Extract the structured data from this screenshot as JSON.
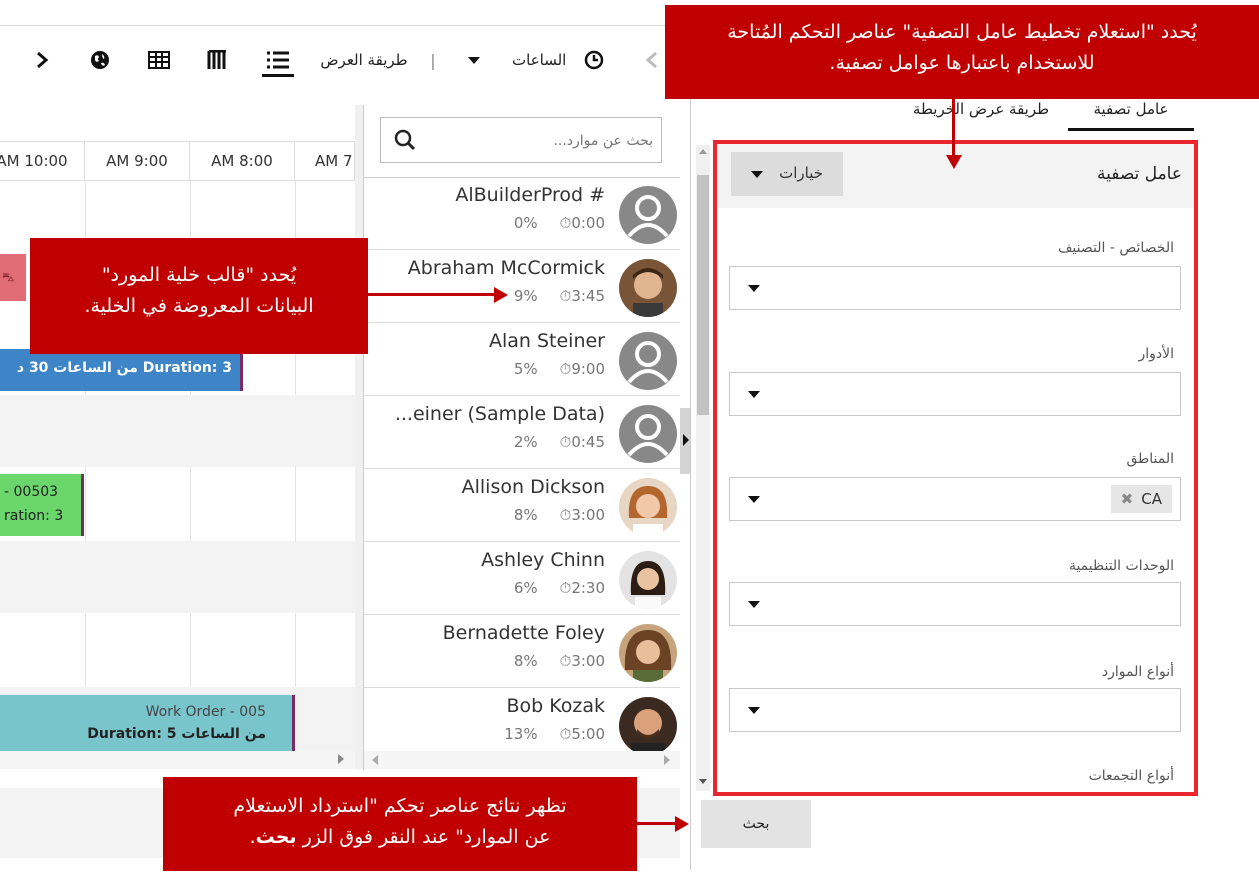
{
  "toolbar": {
    "view_mode_label": "طريقة العرض",
    "hours_label": "الساعات",
    "separator": "|",
    "next_label": ">"
  },
  "timeline": {
    "hours": [
      "AM 7",
      "AM 8:00",
      "AM 9:00",
      "AM 10:00"
    ],
    "bookings": {
      "b1_text": "Duration: 3 من الساعات 30 د",
      "b2_line1": "- 00503",
      "b2_line2": "ration: 3",
      "b3_line1": "Work Order - 005",
      "b3_line2": "Duration: 5 من الساعات"
    }
  },
  "search": {
    "placeholder": "بحث عن موارد..."
  },
  "resources": [
    {
      "name": "AlBuilderProd #",
      "pct": "0%",
      "time": "0:00"
    },
    {
      "name": "Abraham McCormick",
      "pct": "9%",
      "time": "3:45"
    },
    {
      "name": "Alan Steiner",
      "pct": "5%",
      "time": "9:00"
    },
    {
      "name": "...einer (Sample Data)",
      "pct": "2%",
      "time": "0:45"
    },
    {
      "name": "Allison Dickson",
      "pct": "8%",
      "time": "3:00"
    },
    {
      "name": "Ashley Chinn",
      "pct": "6%",
      "time": "2:30"
    },
    {
      "name": "Bernadette Foley",
      "pct": "8%",
      "time": "3:00"
    },
    {
      "name": "Bob Kozak",
      "pct": "13%",
      "time": "5:00"
    }
  ],
  "filter_tabs": {
    "filter": "عامل تصفية",
    "map": "طريقة عرض الخريطة"
  },
  "filter": {
    "title": "عامل تصفية",
    "options_button": "خيارات",
    "fields": [
      {
        "label": "الخصائص - التصنيف"
      },
      {
        "label": "الأدوار"
      },
      {
        "label": "المناطق",
        "chip": "CA"
      },
      {
        "label": "الوحدات التنظيمية"
      },
      {
        "label": "أنواع الموارد"
      },
      {
        "label": "أنواع التجمعات"
      }
    ],
    "search_button": "بحث"
  },
  "callouts": {
    "top_line1": "يُحدد \"استعلام تخطيط عامل التصفية\" عناصر التحكم المُتاحة",
    "top_line2": "للاستخدام باعتبارها عوامل تصفية.",
    "mid_line1": "يُحدد \"قالب خلية المورد\"",
    "mid_line2": "البيانات المعروضة في الخلية.",
    "bot_line1": "تظهر نتائج عناصر تحكم \"استرداد الاستعلام",
    "bot_line2_part1": "عن الموارد\" عند النقر فوق الزر ",
    "bot_line2_bold": "بحث",
    "bot_line2_end": "."
  },
  "colors": {
    "callout_red": "#c00000",
    "filter_border_red": "#e8262d",
    "booking_blue": "#3d85c6",
    "booking_green": "#6ad66b",
    "booking_teal": "#79c5cc",
    "booking_pink": "#e06c75"
  }
}
